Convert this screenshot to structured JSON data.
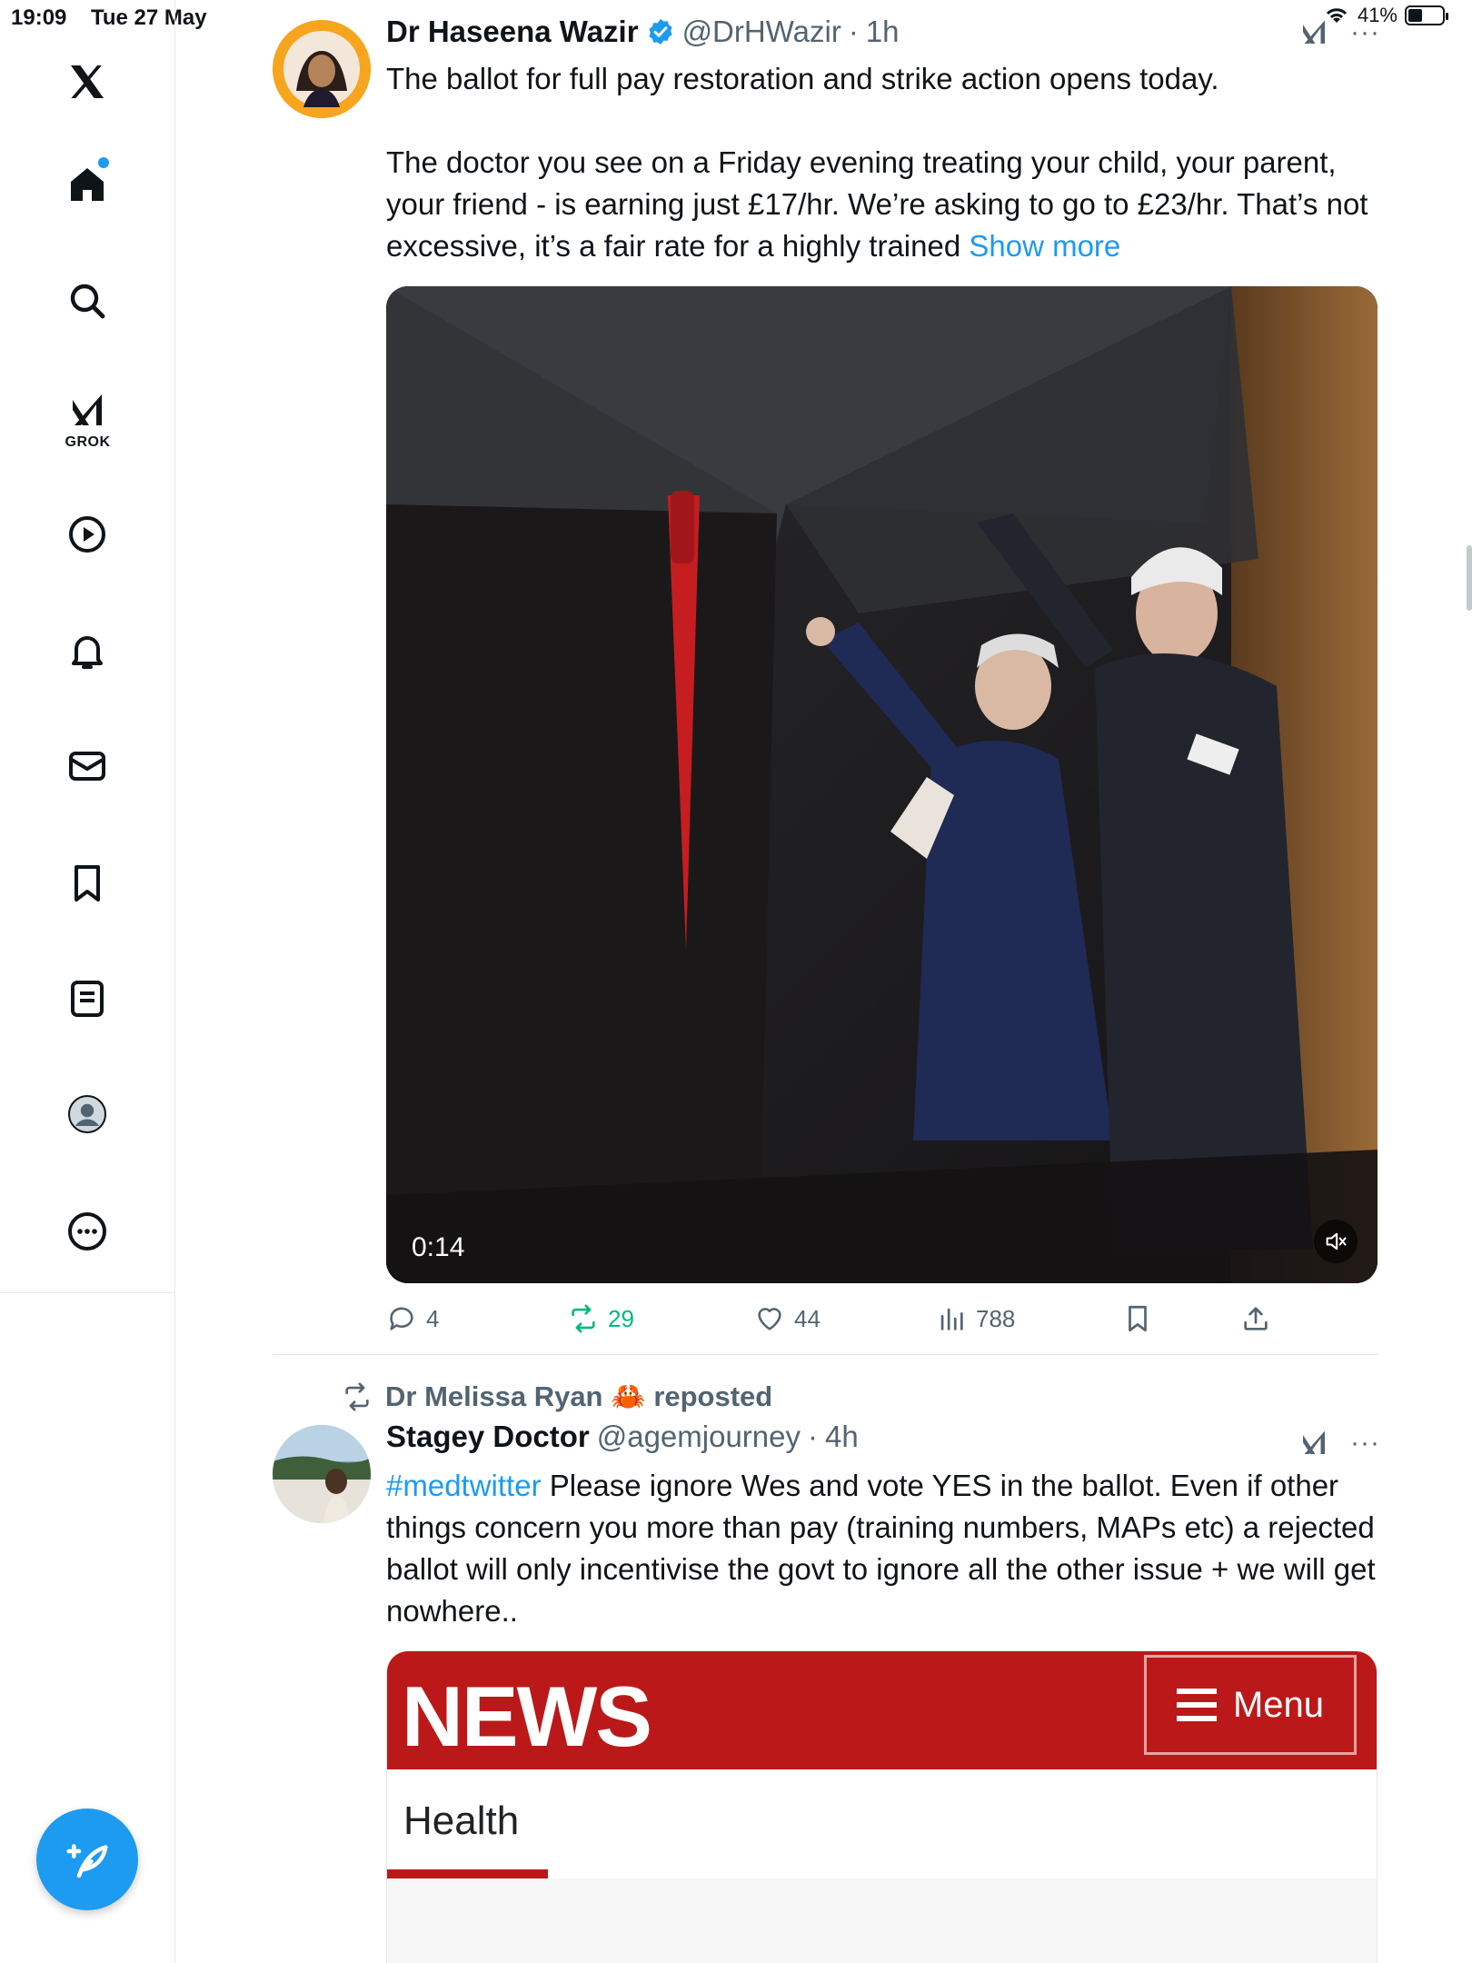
{
  "status_bar": {
    "time": "19:09",
    "date": "Tue 27 May",
    "battery_text": "41%",
    "battery_level": 0.41
  },
  "sidebar": {
    "grok_label": "GROK",
    "items": [
      {
        "icon": "x-logo-icon"
      },
      {
        "icon": "home-icon"
      },
      {
        "icon": "search-icon"
      },
      {
        "icon": "grok-icon"
      },
      {
        "icon": "video-play-icon"
      },
      {
        "icon": "notifications-bell-icon"
      },
      {
        "icon": "messages-mail-icon"
      },
      {
        "icon": "bookmarks-icon"
      },
      {
        "icon": "lists-icon"
      },
      {
        "icon": "profile-avatar-icon"
      },
      {
        "icon": "more-options-icon"
      }
    ],
    "compose_icon": "compose-feather-icon",
    "accent_color": "#1d9bf0"
  },
  "tweet1": {
    "author_name": "Dr Haseena Wazir",
    "handle": "@DrHWazir",
    "separator": "·",
    "time": "1h",
    "text_line1": "The ballot for full pay restoration and strike action opens today.",
    "text_para2": "The doctor you see on a Friday evening treating your child, your parent, your friend - is earning just £17/hr. We’re asking to go to £23/hr. That’s not excessive, it’s a fair rate for a highly trained",
    "show_more": "Show more",
    "video_duration": "0:14",
    "actions": {
      "replies": "4",
      "reposts": "29",
      "likes": "44",
      "views": "788"
    }
  },
  "tweet2": {
    "reposted_by": "Dr Melissa Ryan 🦀 reposted",
    "author_name": "Stagey Doctor",
    "handle": "@agemjourney",
    "separator": "·",
    "time": "4h",
    "hashtag": "#medtwitter",
    "text": "Please ignore Wes and vote YES in the ballot. Even if other things concern you more than pay (training numbers, MAPs etc) a rejected ballot will only incentivise the govt to ignore all the other issue + we will get nowhere..",
    "embed": {
      "logo": "NEWS",
      "menu_label": "Menu",
      "section": "Health",
      "brand_color": "#bb1919"
    }
  },
  "colors": {
    "text": "#0f1419",
    "secondary": "#536471",
    "link": "#1d9bf0",
    "repost_green": "#00ba7c"
  }
}
